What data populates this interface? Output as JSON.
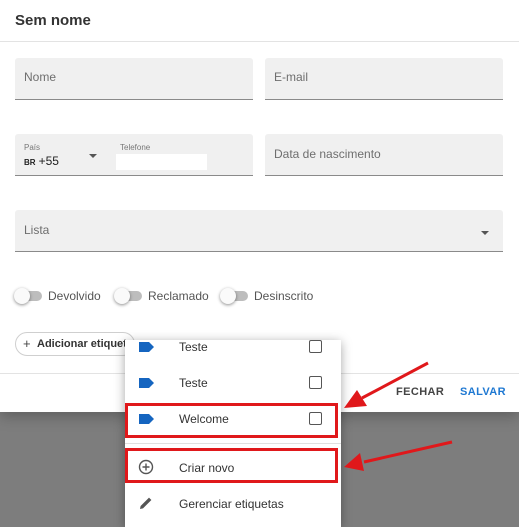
{
  "dialog": {
    "title": "Sem nome",
    "fields": {
      "name_label": "Nome",
      "email_label": "E-mail",
      "country_label": "País",
      "country_code": "BR",
      "country_dial": "+55",
      "phone_label": "Telefone",
      "birthdate_label": "Data de nascimento",
      "list_label": "Lista"
    },
    "toggles": [
      "Devolvido",
      "Reclamado",
      "Desinscrito"
    ],
    "add_tag_label": "Adicionar etiqueta",
    "close_label": "FECHAR",
    "save_label": "SALVAR"
  },
  "tag_menu": {
    "items": [
      {
        "label": "Teste",
        "checked": false,
        "icon": "label-tag-icon"
      },
      {
        "label": "Teste",
        "checked": false,
        "icon": "label-tag-icon"
      },
      {
        "label": "Welcome",
        "checked": false,
        "icon": "label-tag-icon"
      }
    ],
    "actions": [
      {
        "label": "Criar novo",
        "icon": "add-circle-icon"
      },
      {
        "label": "Gerenciar etiquetas",
        "icon": "pencil-icon"
      }
    ]
  },
  "colors": {
    "accent": "#1e78d2",
    "tag": "#1565c0",
    "annotation": "#e0181b",
    "backdrop": "#7d7d7d"
  }
}
